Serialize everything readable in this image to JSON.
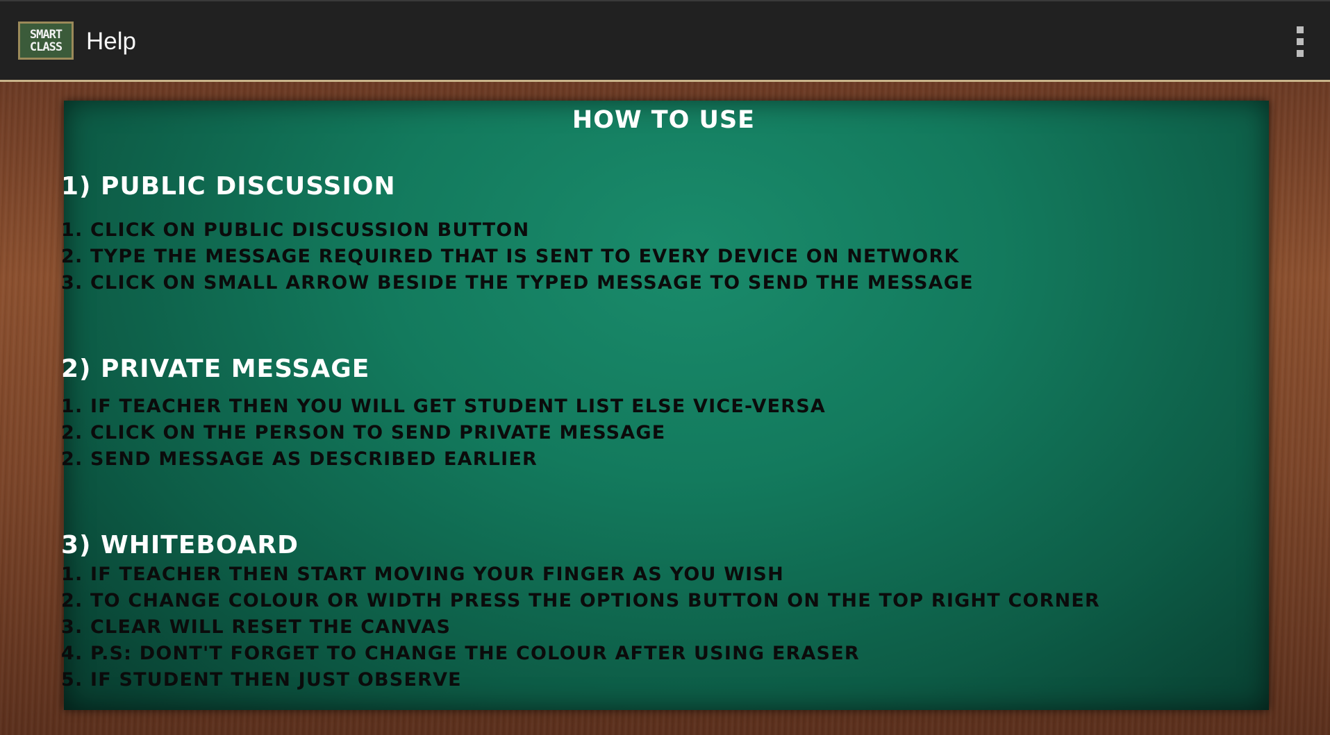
{
  "appbar": {
    "logo_line1": "SMART",
    "logo_line2": "CLASS",
    "title": "Help"
  },
  "board": {
    "heading": "HOW TO USE",
    "sections": [
      {
        "title": "1) PUBLIC DISCUSSION",
        "lines": [
          "1. CLICK ON PUBLIC DISCUSSION BUTTON",
          "2. TYPE THE MESSAGE REQUIRED THAT IS SENT TO EVERY DEVICE ON NETWORK",
          "3. CLICK ON SMALL ARROW BESIDE THE TYPED MESSAGE TO SEND THE MESSAGE"
        ]
      },
      {
        "title": "2) PRIVATE MESSAGE",
        "lines": [
          "1. IF TEACHER THEN YOU WILL GET STUDENT LIST ELSE VICE-VERSA",
          "2. CLICK ON THE PERSON TO SEND PRIVATE MESSAGE",
          "2. SEND MESSAGE AS DESCRIBED EARLIER"
        ]
      },
      {
        "title": "3) WHITEBOARD",
        "lines": [
          "1. IF TEACHER THEN START MOVING YOUR FINGER AS YOU WISH",
          "2. TO CHANGE COLOUR OR WIDTH PRESS THE OPTIONS BUTTON ON THE TOP RIGHT CORNER",
          "3. CLEAR WILL RESET THE CANVAS",
          "4. P.S: DONT'T FORGET TO CHANGE THE COLOUR AFTER USING ERASER",
          "5. IF STUDENT THEN JUST OBSERVE"
        ]
      }
    ]
  },
  "colors": {
    "appbar": "#212121",
    "board_green": "#137a5d",
    "frame_wood": "#7a4428",
    "chalk_white": "#ffffff",
    "text_dark": "#0b0b0b"
  },
  "icons": {
    "overflow": "overflow-menu-icon"
  }
}
